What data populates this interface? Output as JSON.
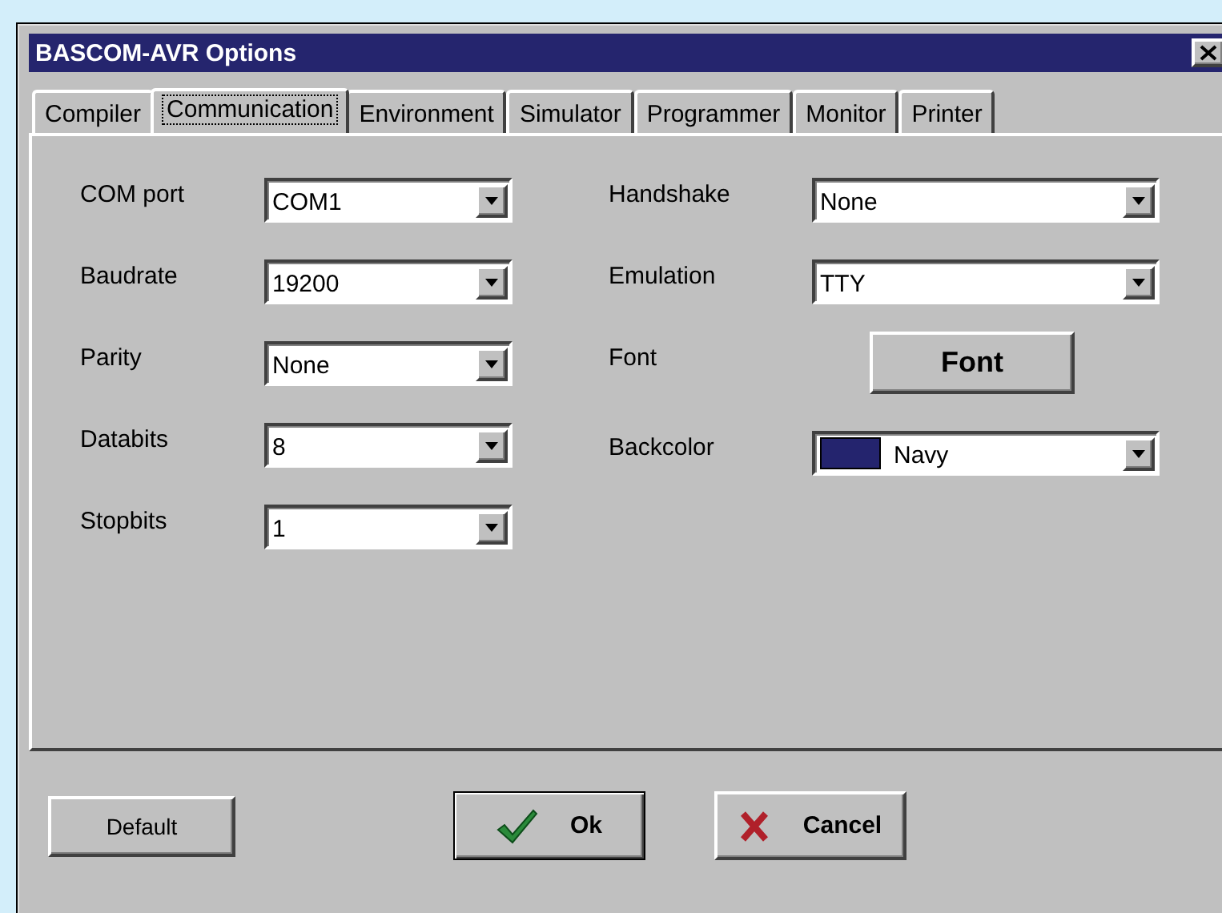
{
  "window": {
    "title": "BASCOM-AVR Options"
  },
  "tabs": [
    {
      "label": "Compiler",
      "selected": false
    },
    {
      "label": "Communication",
      "selected": true
    },
    {
      "label": "Environment",
      "selected": false
    },
    {
      "label": "Simulator",
      "selected": false
    },
    {
      "label": "Programmer",
      "selected": false
    },
    {
      "label": "Monitor",
      "selected": false
    },
    {
      "label": "Printer",
      "selected": false
    }
  ],
  "left_fields": [
    {
      "label": "COM port",
      "value": "COM1"
    },
    {
      "label": "Baudrate",
      "value": "19200"
    },
    {
      "label": "Parity",
      "value": "None"
    },
    {
      "label": "Databits",
      "value": "8"
    },
    {
      "label": "Stopbits",
      "value": "1"
    }
  ],
  "right_fields": [
    {
      "kind": "combo",
      "label": "Handshake",
      "value": "None"
    },
    {
      "kind": "combo",
      "label": "Emulation",
      "value": "TTY"
    },
    {
      "kind": "button",
      "label": "Font",
      "value": "Font"
    },
    {
      "kind": "color",
      "label": "Backcolor",
      "value": "Navy",
      "color": "#24246e"
    }
  ],
  "buttons": [
    {
      "kind": "plain",
      "label": "Default"
    },
    {
      "kind": "ok",
      "label": "Ok"
    },
    {
      "kind": "cancel",
      "label": "Cancel"
    }
  ]
}
